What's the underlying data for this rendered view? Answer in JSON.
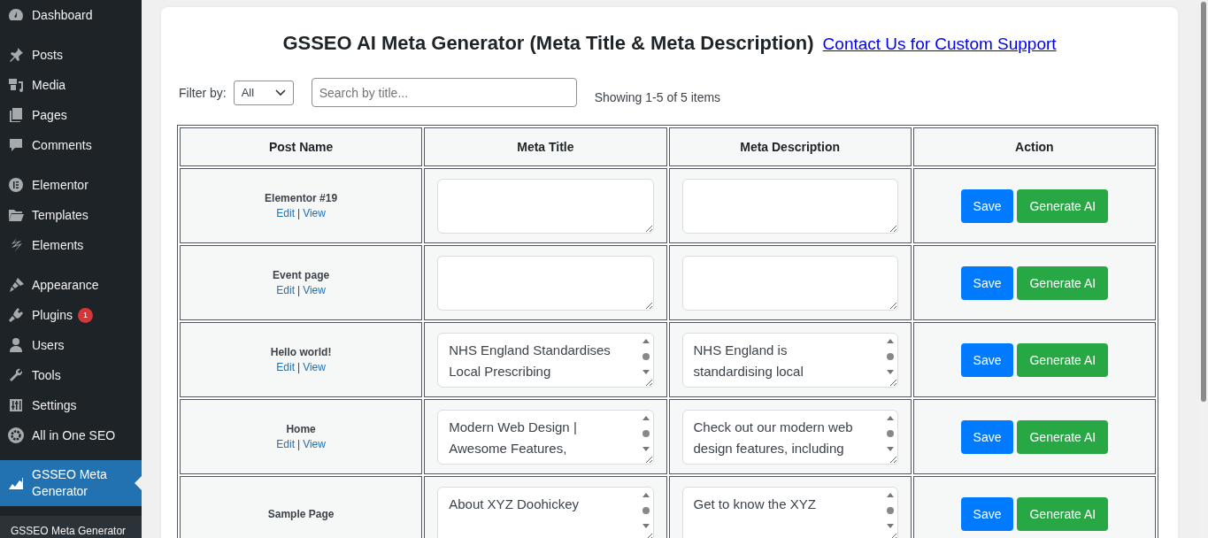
{
  "sidebar": {
    "menu_groups": [
      [
        {
          "label": "Dashboard",
          "kind": "dashboard",
          "selected": false
        }
      ],
      [
        {
          "label": "Posts",
          "kind": "pin",
          "selected": false
        },
        {
          "label": "Media",
          "kind": "media",
          "selected": false
        },
        {
          "label": "Pages",
          "kind": "pages",
          "selected": false
        },
        {
          "label": "Comments",
          "kind": "comment",
          "selected": false
        }
      ],
      [
        {
          "label": "Elementor",
          "kind": "elementor",
          "selected": false
        },
        {
          "label": "Templates",
          "kind": "folder",
          "selected": false
        },
        {
          "label": "Elements",
          "kind": "bolt",
          "selected": false
        }
      ],
      [
        {
          "label": "Appearance",
          "kind": "brush",
          "selected": false
        },
        {
          "label": "Plugins",
          "kind": "plug",
          "selected": false,
          "badge": "1"
        },
        {
          "label": "Users",
          "kind": "user",
          "selected": false
        },
        {
          "label": "Tools",
          "kind": "wrench",
          "selected": false
        },
        {
          "label": "Settings",
          "kind": "sliders",
          "selected": false
        },
        {
          "label": "All in One SEO",
          "kind": "gear",
          "selected": false
        }
      ],
      [
        {
          "label": "GSSEO Meta Generator",
          "kind": "chart",
          "selected": true
        }
      ]
    ],
    "submenu": [
      {
        "label": "GSSEO Meta Generator"
      }
    ]
  },
  "page": {
    "title": "GSSEO AI Meta Generator (Meta Title & Meta Description)",
    "support_link": "Contact Us for Custom Support",
    "filter": {
      "label": "Filter by:",
      "value": "All"
    },
    "search": {
      "placeholder": "Search by title..."
    },
    "count": "Showing 1-5 of 5 items"
  },
  "table": {
    "columns": [
      "Post Name",
      "Meta Title",
      "Meta Description",
      "Action"
    ],
    "rows": [
      {
        "post_name": "Elementor #19",
        "links": [
          {
            "kind": "link",
            "text": "Edit"
          },
          {
            "kind": "separator",
            "text": "|"
          },
          {
            "kind": "link",
            "text": "View"
          }
        ],
        "meta_title": "",
        "meta_description": "",
        "buttons": [
          "Save",
          "Generate AI"
        ]
      },
      {
        "post_name": "Event page",
        "links": [
          {
            "kind": "link",
            "text": "Edit"
          },
          {
            "kind": "separator",
            "text": "|"
          },
          {
            "kind": "link",
            "text": "View"
          }
        ],
        "meta_title": "",
        "meta_description": "",
        "buttons": [
          "Save",
          "Generate AI"
        ]
      },
      {
        "post_name": "Hello world!",
        "links": [
          {
            "kind": "link",
            "text": "Edit"
          },
          {
            "kind": "separator",
            "text": "|"
          },
          {
            "kind": "link",
            "text": "View"
          }
        ],
        "meta_title": "NHS England Standardises Local Prescribing",
        "meta_description": "NHS England is standardising local",
        "buttons": [
          "Save",
          "Generate AI"
        ]
      },
      {
        "post_name": "Home",
        "links": [
          {
            "kind": "link",
            "text": "Edit"
          },
          {
            "kind": "separator",
            "text": "|"
          },
          {
            "kind": "link",
            "text": "View"
          }
        ],
        "meta_title": "Modern Web Design | Awesome Features,",
        "meta_description": "Check out our modern web design features, including",
        "buttons": [
          "Save",
          "Generate AI"
        ]
      },
      {
        "post_name": "Sample Page",
        "links": [],
        "meta_title": "About XYZ Doohickey",
        "meta_description": "Get to know the XYZ",
        "buttons": [
          "Save",
          "Generate AI"
        ]
      }
    ]
  }
}
